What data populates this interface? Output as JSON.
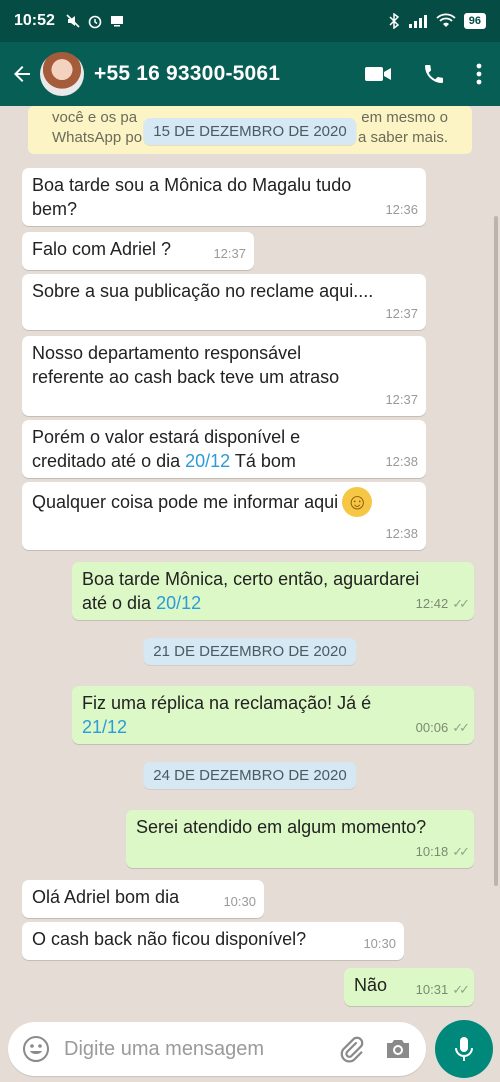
{
  "status": {
    "time": "10:52",
    "battery": "96"
  },
  "header": {
    "contact": "+55 16 93300-5061"
  },
  "banner": {
    "line1_left": "você e os pa",
    "line1_right": "em mesmo o",
    "line2_left": "WhatsApp po",
    "line2_right": "a saber mais."
  },
  "dates": {
    "d1": "15 DE DEZEMBRO DE 2020",
    "d2": "21 DE DEZEMBRO DE 2020",
    "d3": "24 DE DEZEMBRO DE 2020"
  },
  "messages": [
    {
      "text1": "Boa tarde sou a Mônica do Magalu tudo",
      "text2": "bem?",
      "time": "12:36"
    },
    {
      "text1": "Falo com Adriel ?",
      "time": "12:37"
    },
    {
      "text1": "Sobre a sua publicação no reclame aqui....",
      "time": "12:37"
    },
    {
      "text1": "Nosso departamento responsável",
      "text2": "referente ao cash back teve um atraso",
      "time": "12:37"
    },
    {
      "text1": "Porém o valor estará disponível  e",
      "text2a": "creditado até o dia ",
      "link": "20/12",
      "text2b": " Tá bom",
      "time": "12:38"
    },
    {
      "text1": "Qualquer coisa pode me informar aqui ",
      "emoji": "☺",
      "time": "12:38"
    },
    {
      "text1": "Boa tarde Mônica, certo então, aguardarei",
      "text2a": "até o dia ",
      "link": "20/12",
      "time": "12:42"
    },
    {
      "text1": "Fiz uma réplica na reclamação! Já é",
      "link": "21/12",
      "time": "00:06"
    },
    {
      "text1": "Serei atendido em algum momento?",
      "time": "10:18"
    },
    {
      "text1": "Olá Adriel bom dia",
      "time": "10:30"
    },
    {
      "text1": "O cash back não ficou disponível?",
      "time": "10:30"
    },
    {
      "text1": "Não",
      "time": "10:31"
    }
  ],
  "input": {
    "placeholder": "Digite uma mensagem"
  }
}
